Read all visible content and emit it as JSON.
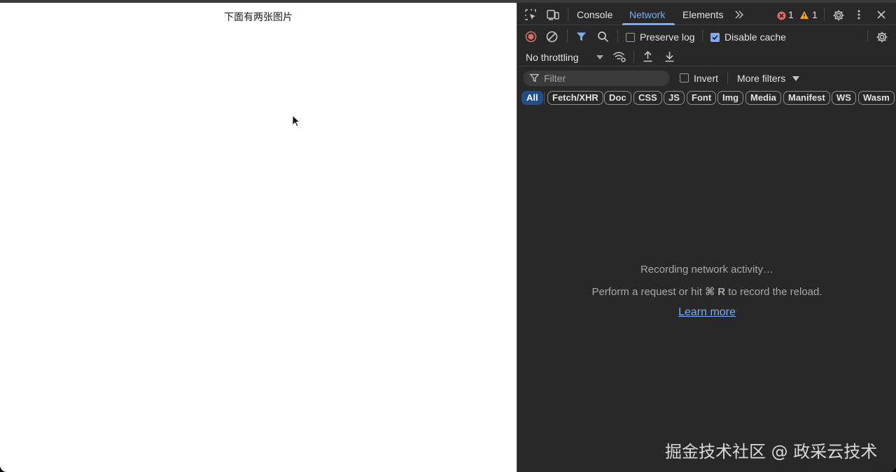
{
  "page": {
    "text": "下面有两张图片"
  },
  "devtools": {
    "tabs": [
      {
        "label": "Console"
      },
      {
        "label": "Network"
      },
      {
        "label": "Elements"
      }
    ],
    "error_count": "1",
    "warning_count": "1",
    "toolbar": {
      "preserve_log_label": "Preserve log",
      "preserve_log_checked": false,
      "disable_cache_label": "Disable cache",
      "disable_cache_checked": true
    },
    "throttling": {
      "selected": "No throttling"
    },
    "filter": {
      "placeholder": "Filter",
      "invert_label": "Invert",
      "more_filters_label": "More filters"
    },
    "types": [
      "All",
      "Fetch/XHR",
      "Doc",
      "CSS",
      "JS",
      "Font",
      "Img",
      "Media",
      "Manifest",
      "WS",
      "Wasm"
    ],
    "empty_state": {
      "line1": "Recording network activity…",
      "line2_prefix": "Perform a request or hit ",
      "shortcut": "⌘ R",
      "line2_suffix": " to record the reload.",
      "link": "Learn more"
    }
  },
  "colors": {
    "accent": "#7cacf8",
    "panel_bg": "#282828",
    "error": "#e46962",
    "warning": "#f2a33a",
    "record": "#e46962"
  },
  "icons": [
    "inspect-element-icon",
    "device-toolbar-icon",
    "more-tabs-icon",
    "error-icon",
    "warning-icon",
    "settings-icon",
    "kebab-menu-icon",
    "close-icon",
    "record-icon",
    "clear-icon",
    "filter-funnel-icon",
    "search-icon",
    "network-settings-icon",
    "dropdown-arrow-icon",
    "network-conditions-icon",
    "upload-icon",
    "download-icon"
  ],
  "watermark": "掘金技术社区 @ 政采云技术"
}
